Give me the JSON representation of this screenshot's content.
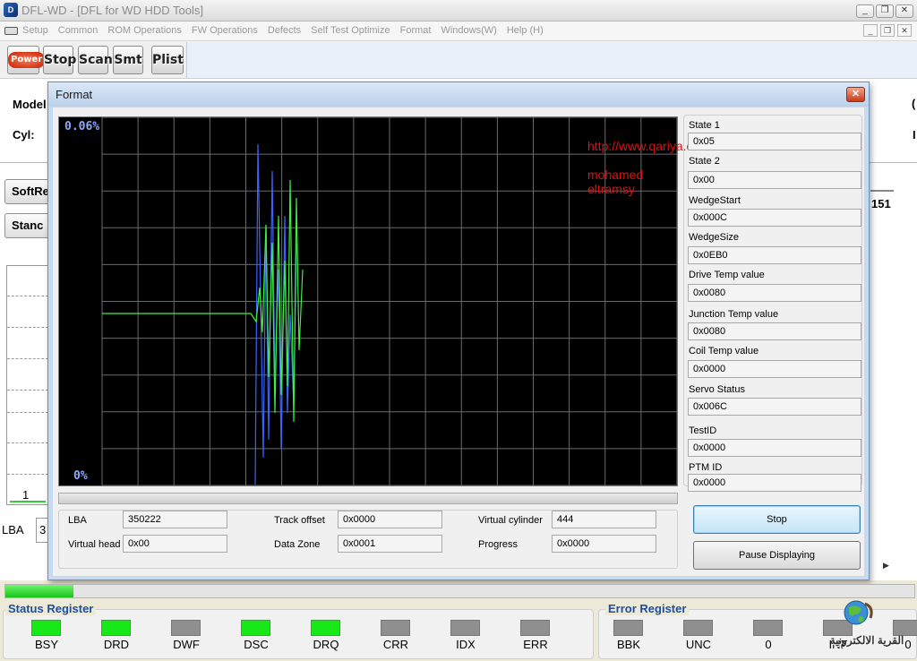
{
  "app": {
    "title": "DFL-WD - [DFL for WD HDD Tools]",
    "icon_text": "D"
  },
  "window_buttons": [
    "_",
    "❐",
    "✕"
  ],
  "mdi_buttons": [
    "_",
    "❐",
    "✕"
  ],
  "menu": [
    "Setup",
    "Common",
    "ROM Operations",
    "FW Operations",
    "Defects",
    "Self Test Optimize",
    "Format",
    "Windows(W)",
    "Help (H)"
  ],
  "toolbar": {
    "power": "Power",
    "stop": "Stop",
    "scan": "Scan",
    "smt": "Smt",
    "plist": "Plist"
  },
  "background": {
    "model_label": "Model",
    "cyl_label": "Cyl:",
    "soft_reset_btn": "SoftRe",
    "standby_btn": "Stanc",
    "graph_num": "1",
    "lba_label": "LBA",
    "lba_value": "3",
    "right_value": "151",
    "right_c1": "(",
    "right_c2": "I"
  },
  "dialog": {
    "title": "Format",
    "close": "✕",
    "graph_top": "0.06%",
    "graph_bottom": "0%",
    "watermark_url": "http://www.qariya.com",
    "watermark_name": "mohamed eltramsy",
    "status": [
      {
        "label": "State 1",
        "value": "0x05"
      },
      {
        "label": "State 2",
        "value": "0x00"
      },
      {
        "label": "WedgeStart",
        "value": "0x000C"
      },
      {
        "label": "WedgeSize",
        "value": "0x0EB0"
      },
      {
        "label": "Drive Temp value",
        "value": "0x0080"
      },
      {
        "label": "Junction Temp value",
        "value": "0x0080"
      },
      {
        "label": "Coil Temp value",
        "value": "0x0000"
      },
      {
        "label": "Servo Status",
        "value": "0x006C"
      },
      {
        "label": "TestID",
        "value": "0x0000"
      },
      {
        "label": "PTM ID",
        "value": "0x0000"
      }
    ],
    "info": {
      "lba_label": "LBA",
      "lba_value": "350222",
      "track_offset_label": "Track offset",
      "track_offset_value": "0x0000",
      "virtual_cylinder_label": "Virtual cylinder",
      "virtual_cylinder_value": "444",
      "virtual_head_label": "Virtual head",
      "virtual_head_value": "0x00",
      "data_zone_label": "Data Zone",
      "data_zone_value": "0x0001",
      "progress_label": "Progress",
      "progress_value": "0x0000"
    },
    "stop_button": "Stop",
    "pause_button": "Pause Displaying"
  },
  "main_progress": 0.075,
  "status_register": {
    "title": "Status Register",
    "leds": [
      {
        "label": "BSY",
        "on": true
      },
      {
        "label": "DRD",
        "on": true
      },
      {
        "label": "DWF",
        "on": false
      },
      {
        "label": "DSC",
        "on": true
      },
      {
        "label": "DRQ",
        "on": true
      },
      {
        "label": "CRR",
        "on": false
      },
      {
        "label": "IDX",
        "on": false
      },
      {
        "label": "ERR",
        "on": false
      }
    ]
  },
  "error_register": {
    "title": "Error Register",
    "leds": [
      {
        "label": "BBK",
        "on": false
      },
      {
        "label": "UNC",
        "on": false
      },
      {
        "label": "0",
        "on": false
      },
      {
        "label": "INF",
        "on": false
      },
      {
        "label": "0",
        "on": false
      }
    ]
  },
  "logo_text": "القرية الالكترونية",
  "colors": {
    "led_on": "#18e818",
    "led_off": "#8f8f8f",
    "trace_blue": "#3a64ff",
    "trace_green": "#3cf03c",
    "grid": "#6b6b6b"
  }
}
